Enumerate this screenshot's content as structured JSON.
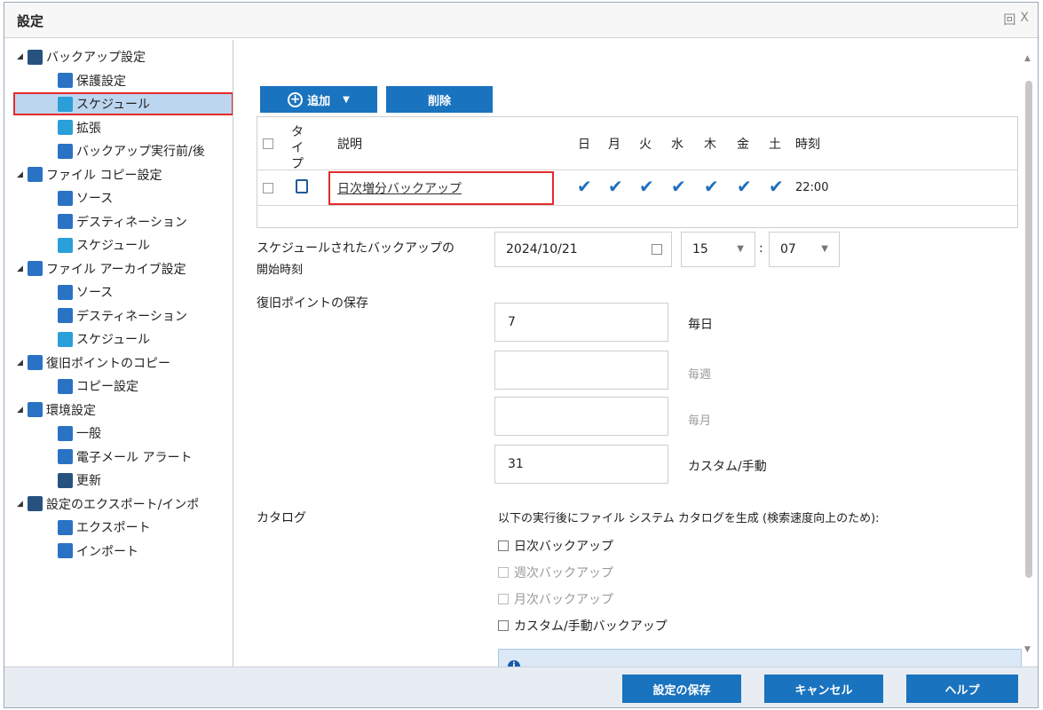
{
  "window": {
    "title": "設定",
    "controls": [
      "回",
      "X"
    ]
  },
  "sidebar": {
    "items": [
      {
        "label": "バックアップ設定",
        "icon": "backup-icon",
        "level": 0,
        "expanded": true
      },
      {
        "label": "保護設定",
        "icon": "protection-icon",
        "level": 1
      },
      {
        "label": "スケジュール",
        "icon": "schedule-icon",
        "level": 1,
        "selected": true
      },
      {
        "label": "拡張",
        "icon": "advanced-icon",
        "level": 1
      },
      {
        "label": "バックアップ実行前/後",
        "icon": "pre-post-icon",
        "level": 1
      },
      {
        "label": "ファイル コピー設定",
        "icon": "file-copy-icon",
        "level": 0,
        "expanded": true
      },
      {
        "label": "ソース",
        "icon": "source-icon",
        "level": 1
      },
      {
        "label": "デスティネーション",
        "icon": "destination-icon",
        "level": 1
      },
      {
        "label": "スケジュール",
        "icon": "schedule-icon",
        "level": 1
      },
      {
        "label": "ファイル アーカイブ設定",
        "icon": "file-archive-icon",
        "level": 0,
        "expanded": true
      },
      {
        "label": "ソース",
        "icon": "source-icon",
        "level": 1
      },
      {
        "label": "デスティネーション",
        "icon": "destination-icon",
        "level": 1
      },
      {
        "label": "スケジュール",
        "icon": "schedule-icon",
        "level": 1
      },
      {
        "label": "復旧ポイントのコピー",
        "icon": "recovery-point-copy-icon",
        "level": 0,
        "expanded": true
      },
      {
        "label": "コピー設定",
        "icon": "copy-settings-icon",
        "level": 1
      },
      {
        "label": "環境設定",
        "icon": "preferences-icon",
        "level": 0,
        "expanded": true
      },
      {
        "label": "一般",
        "icon": "general-icon",
        "level": 1
      },
      {
        "label": "電子メール アラート",
        "icon": "email-alert-icon",
        "level": 1
      },
      {
        "label": "更新",
        "icon": "update-icon",
        "level": 1
      },
      {
        "label": "設定のエクスポート/インポ",
        "icon": "export-import-icon",
        "level": 0,
        "expanded": true
      },
      {
        "label": "エクスポート",
        "icon": "export-icon",
        "level": 1
      },
      {
        "label": "インポート",
        "icon": "import-icon",
        "level": 1
      }
    ]
  },
  "toolbar": {
    "add_label": "追加",
    "delete_label": "削除"
  },
  "schedule_table": {
    "headers": {
      "type": "タイプ",
      "description": "説明",
      "days": [
        "日",
        "月",
        "火",
        "水",
        "木",
        "金",
        "土"
      ],
      "time": "時刻"
    },
    "rows": [
      {
        "description": "日次増分バックアップ",
        "days_checked": [
          true,
          true,
          true,
          true,
          true,
          true,
          true
        ],
        "time": "22:00"
      }
    ]
  },
  "start_time": {
    "label_line1": "スケジュールされたバックアップの",
    "label_line2": "開始時刻",
    "date": "2024/10/21",
    "hour": "15",
    "separator": ":",
    "minute": "07"
  },
  "retention": {
    "label": "復旧ポイントの保存",
    "daily_value": "7",
    "daily_label": "毎日",
    "weekly_value": "",
    "weekly_label": "毎週",
    "monthly_value": "",
    "monthly_label": "毎月",
    "custom_value": "31",
    "custom_label": "カスタム/手動"
  },
  "catalog": {
    "label": "カタログ",
    "description": "以下の実行後にファイル システム カタログを生成 (検索速度向上のため):",
    "options": [
      {
        "label": "日次バックアップ",
        "enabled": true,
        "checked": false
      },
      {
        "label": "週次バックアップ",
        "enabled": false,
        "checked": false
      },
      {
        "label": "月次バックアップ",
        "enabled": false,
        "checked": false
      },
      {
        "label": "カスタム/手動バックアップ",
        "enabled": true,
        "checked": false
      }
    ],
    "info_text": "i"
  },
  "footer": {
    "save_label": "設定の保存",
    "cancel_label": "キャンセル",
    "help_label": "ヘルプ"
  },
  "colors": {
    "accent": "#1a73be",
    "highlight": "#e52a2a",
    "selected_bg": "#bcd6f0"
  }
}
